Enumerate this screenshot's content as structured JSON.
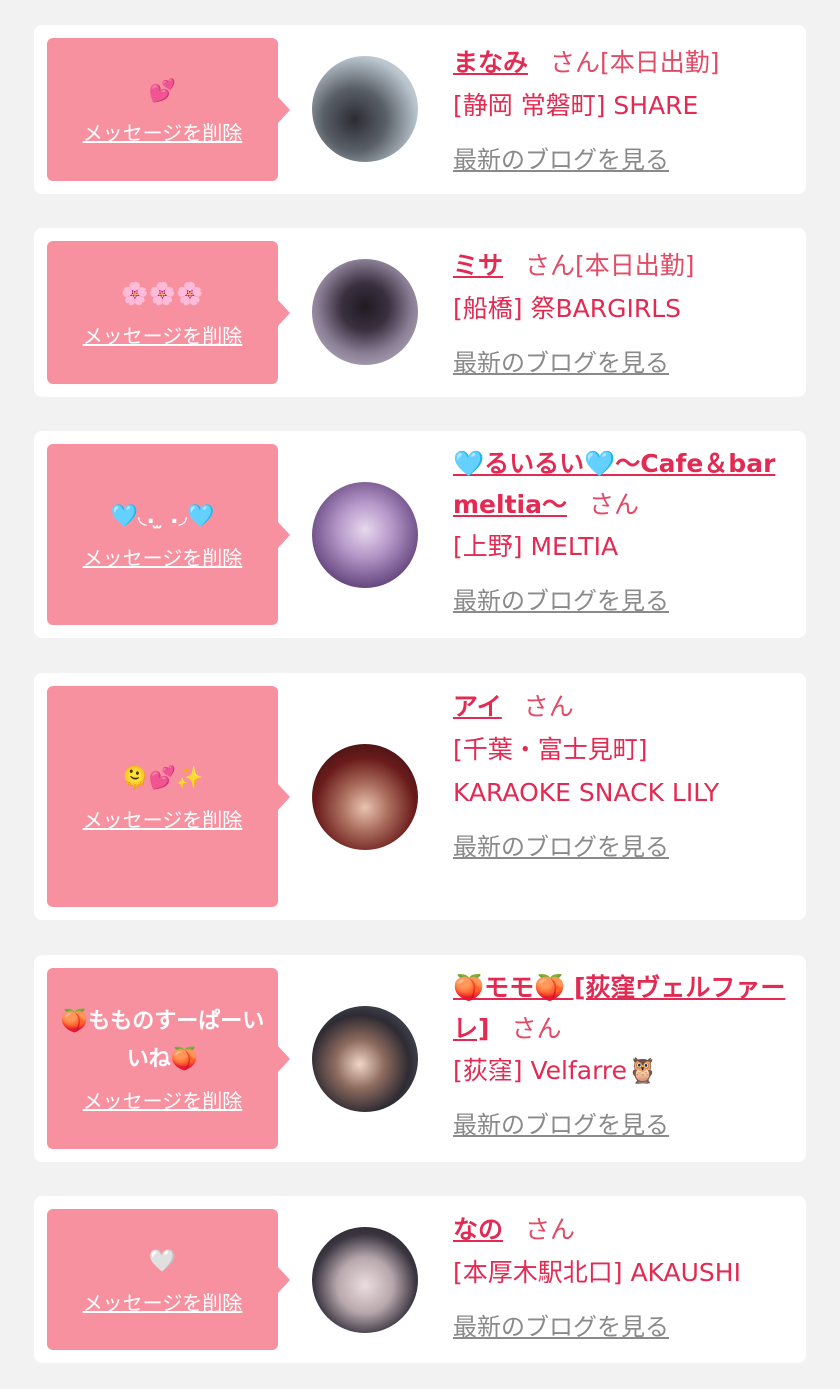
{
  "accent_color": "#f7919f",
  "name_color": "#e22a53",
  "delete_label": "メッセージを削除",
  "blog_label": "最新のブログを見る",
  "san_label": "さん",
  "cards": [
    {
      "message": "💕",
      "name": "まなみ",
      "status": "[本日出勤]",
      "shop": "[静岡 常磐町] SHARE"
    },
    {
      "message": "🌸🌸🌸",
      "name": "ミサ",
      "status": "[本日出勤]",
      "shop": "[船橋] 祭BARGIRLS"
    },
    {
      "message": "🩵◟. ̫ .◞🩵",
      "name": "🩵るいるい🩵〜Cafe＆bar meltia〜",
      "status": "",
      "shop": "[上野] MELTIA"
    },
    {
      "message": "🫠💕✨",
      "name": "アイ",
      "status": "",
      "shop": "[千葉・富士見町] KARAOKE SNACK LILY"
    },
    {
      "message": "🍑もものすーぱーいいね🍑",
      "name": "🍑モモ🍑 [荻窪ヴェルファーレ]",
      "status": "",
      "shop": "[荻窪] Velfarre🦉"
    },
    {
      "message": "🤍",
      "name": "なの",
      "status": "",
      "shop": "[本厚木駅北口] AKAUSHI"
    }
  ]
}
